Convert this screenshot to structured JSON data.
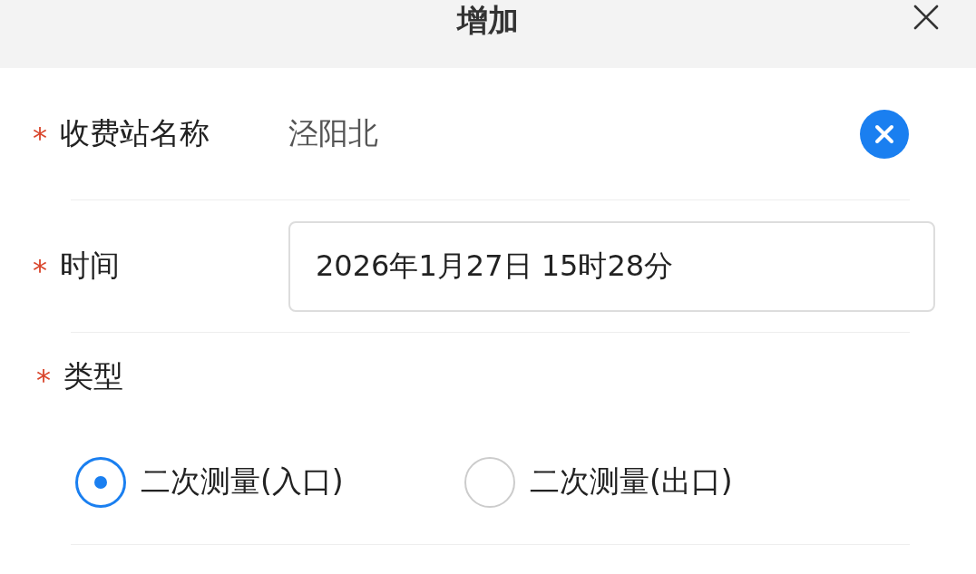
{
  "dialog": {
    "title": "增加"
  },
  "fields": [
    {
      "kind": "text",
      "marker": "*",
      "label": "收费站名称",
      "value": "泾阳北",
      "clearable": true
    },
    {
      "kind": "input",
      "marker": "*",
      "label": "时间",
      "value": "2026年1月27日 15时28分"
    },
    {
      "kind": "radio",
      "marker": "*",
      "label": "类型",
      "options": [
        {
          "label": "二次测量(入口)",
          "selected": true
        },
        {
          "label": "二次测量(出口)",
          "selected": false
        }
      ]
    }
  ]
}
